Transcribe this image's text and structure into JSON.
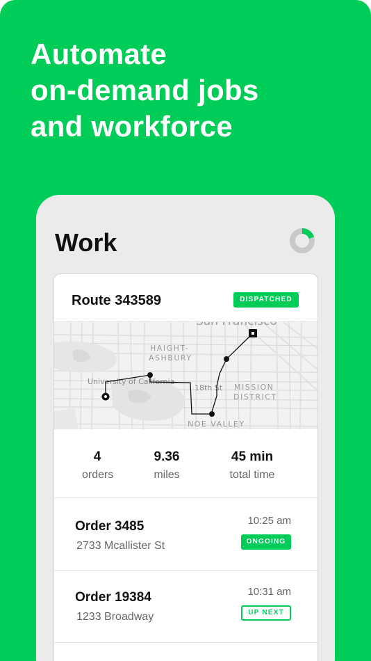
{
  "headline": {
    "line1": "Automate",
    "line2": "on-demand jobs",
    "line3": "and workforce"
  },
  "app": {
    "title": "Work",
    "progress_fraction": 0.2,
    "colors": {
      "accent": "#00cc58",
      "background": "#ebebeb"
    }
  },
  "route": {
    "title": "Route 343589",
    "status": "DISPATCHED",
    "map_labels": {
      "haight": "HAIGHT-",
      "ashbury": "ASHBURY",
      "university": "University of California",
      "street": "18th St",
      "mission": "MISSION",
      "district": "DISTRICT",
      "noe": "NOE VALLEY",
      "city": "San Francisco"
    }
  },
  "stats": [
    {
      "value": "4",
      "label": "orders"
    },
    {
      "value": "9.36",
      "label": "miles"
    },
    {
      "value": "45 min",
      "label": "total time"
    }
  ],
  "orders": [
    {
      "title": "Order 3485",
      "address": "2733 Mcallister St",
      "time": "10:25 am",
      "status": "ONGOING"
    },
    {
      "title": "Order 19384",
      "address": "1233 Broadway",
      "time": "10:31 am",
      "status": "UP NEXT"
    }
  ]
}
